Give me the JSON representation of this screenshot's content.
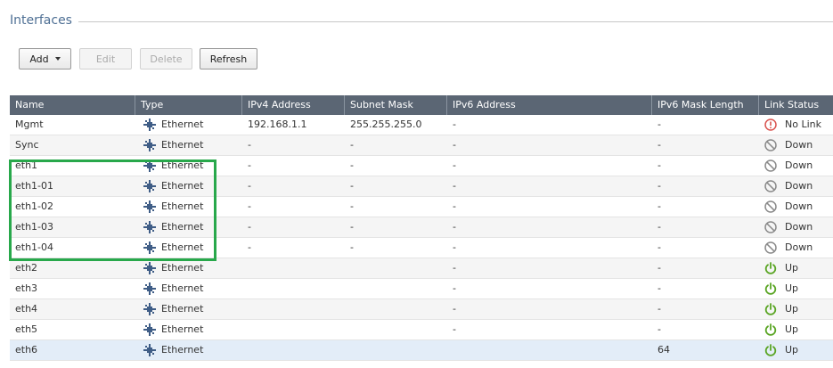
{
  "section": {
    "title": "Interfaces"
  },
  "toolbar": {
    "add_label": "Add",
    "edit_label": "Edit",
    "delete_label": "Delete",
    "refresh_label": "Refresh"
  },
  "table": {
    "columns": [
      "Name",
      "Type",
      "IPv4 Address",
      "Subnet Mask",
      "IPv6 Address",
      "IPv6 Mask Length",
      "Link Status"
    ],
    "rows": [
      {
        "name": "Mgmt",
        "type": "Ethernet",
        "ipv4": "192.168.1.1",
        "mask": "255.255.255.0",
        "ipv6": "-",
        "ipv6_mask": "-",
        "status": "No Link",
        "status_kind": "error"
      },
      {
        "name": "Sync",
        "type": "Ethernet",
        "ipv4": "-",
        "mask": "-",
        "ipv6": "-",
        "ipv6_mask": "-",
        "status": "Down",
        "status_kind": "down"
      },
      {
        "name": "eth1",
        "type": "Ethernet",
        "ipv4": "-",
        "mask": "-",
        "ipv6": "-",
        "ipv6_mask": "-",
        "status": "Down",
        "status_kind": "down"
      },
      {
        "name": "eth1-01",
        "type": "Ethernet",
        "ipv4": "-",
        "mask": "-",
        "ipv6": "-",
        "ipv6_mask": "-",
        "status": "Down",
        "status_kind": "down"
      },
      {
        "name": "eth1-02",
        "type": "Ethernet",
        "ipv4": "-",
        "mask": "-",
        "ipv6": "-",
        "ipv6_mask": "-",
        "status": "Down",
        "status_kind": "down"
      },
      {
        "name": "eth1-03",
        "type": "Ethernet",
        "ipv4": "-",
        "mask": "-",
        "ipv6": "-",
        "ipv6_mask": "-",
        "status": "Down",
        "status_kind": "down"
      },
      {
        "name": "eth1-04",
        "type": "Ethernet",
        "ipv4": "-",
        "mask": "-",
        "ipv6": "-",
        "ipv6_mask": "-",
        "status": "Down",
        "status_kind": "down"
      },
      {
        "name": "eth2",
        "type": "Ethernet",
        "ipv4": "",
        "mask": "",
        "ipv6": "-",
        "ipv6_mask": "-",
        "status": "Up",
        "status_kind": "up"
      },
      {
        "name": "eth3",
        "type": "Ethernet",
        "ipv4": "",
        "mask": "",
        "ipv6": "-",
        "ipv6_mask": "-",
        "status": "Up",
        "status_kind": "up"
      },
      {
        "name": "eth4",
        "type": "Ethernet",
        "ipv4": "",
        "mask": "",
        "ipv6": "-",
        "ipv6_mask": "-",
        "status": "Up",
        "status_kind": "up"
      },
      {
        "name": "eth5",
        "type": "Ethernet",
        "ipv4": "",
        "mask": "",
        "ipv6": "-",
        "ipv6_mask": "-",
        "status": "Up",
        "status_kind": "up"
      },
      {
        "name": "eth6",
        "type": "Ethernet",
        "ipv4": "",
        "mask": "",
        "ipv6": "",
        "ipv6_mask": "64",
        "status": "Up",
        "status_kind": "up"
      }
    ]
  },
  "colors": {
    "header_bg": "#5b6674",
    "title": "#4e6f94",
    "highlight": "#28a84b",
    "up": "#5aa524",
    "error": "#d9534f",
    "down": "#8a8a8a",
    "selected_row": "#e3edf8"
  }
}
